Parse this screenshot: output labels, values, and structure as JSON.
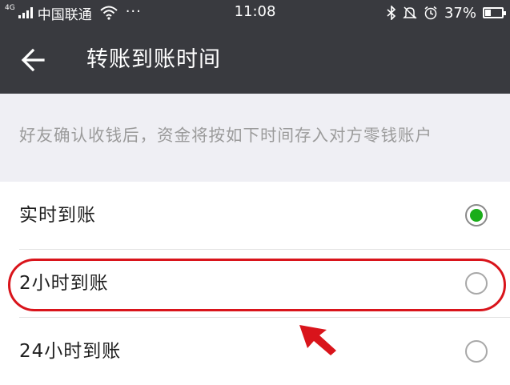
{
  "status_bar": {
    "network": "4G",
    "carrier": "中国联通",
    "dots": "···",
    "time": "11:08",
    "battery_text": "37%",
    "battery_level": 0.37,
    "icons": [
      "signal-icon",
      "wifi-icon",
      "bluetooth-icon",
      "mute-icon",
      "alarm-icon",
      "battery-icon"
    ]
  },
  "header": {
    "title": "转账到账时间",
    "back_icon": "back-arrow-icon"
  },
  "description": "好友确认收钱后，资金将按如下时间存入对方零钱账户",
  "options": [
    {
      "label": "实时到账",
      "selected": true
    },
    {
      "label": "2小时到账",
      "selected": false
    },
    {
      "label": "24小时到账",
      "selected": false
    }
  ],
  "colors": {
    "header_bg": "#393a3f",
    "page_bg": "#efeff4",
    "radio_selected": "#1aad19",
    "annotation_red": "#d9141b"
  },
  "annotation": {
    "highlighted_option": "2小时到账"
  }
}
